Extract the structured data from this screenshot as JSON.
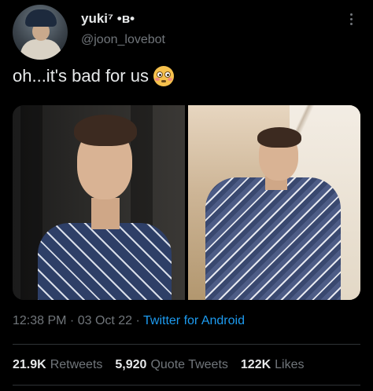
{
  "user": {
    "display_name": "yuki⁷ •ʙ•",
    "handle": "@joon_lovebot"
  },
  "tweet": {
    "text": "oh...it's bad for us",
    "emoji": "flushed-face-emoji"
  },
  "meta": {
    "time": "12:38 PM",
    "separator1": " · ",
    "date": "03 Oct 22",
    "separator2": " · ",
    "source": "Twitter for Android"
  },
  "stats": {
    "retweets": {
      "count": "21.9K",
      "label": "Retweets"
    },
    "quote_tweets": {
      "count": "5,920",
      "label": "Quote Tweets"
    },
    "likes": {
      "count": "122K",
      "label": "Likes"
    }
  },
  "colors": {
    "background": "#000000",
    "text": "#e7e9ea",
    "muted": "#71767b",
    "link": "#1d9bf0",
    "divider": "#2f3336"
  },
  "icons": {
    "more": "more-vertical-icon"
  }
}
